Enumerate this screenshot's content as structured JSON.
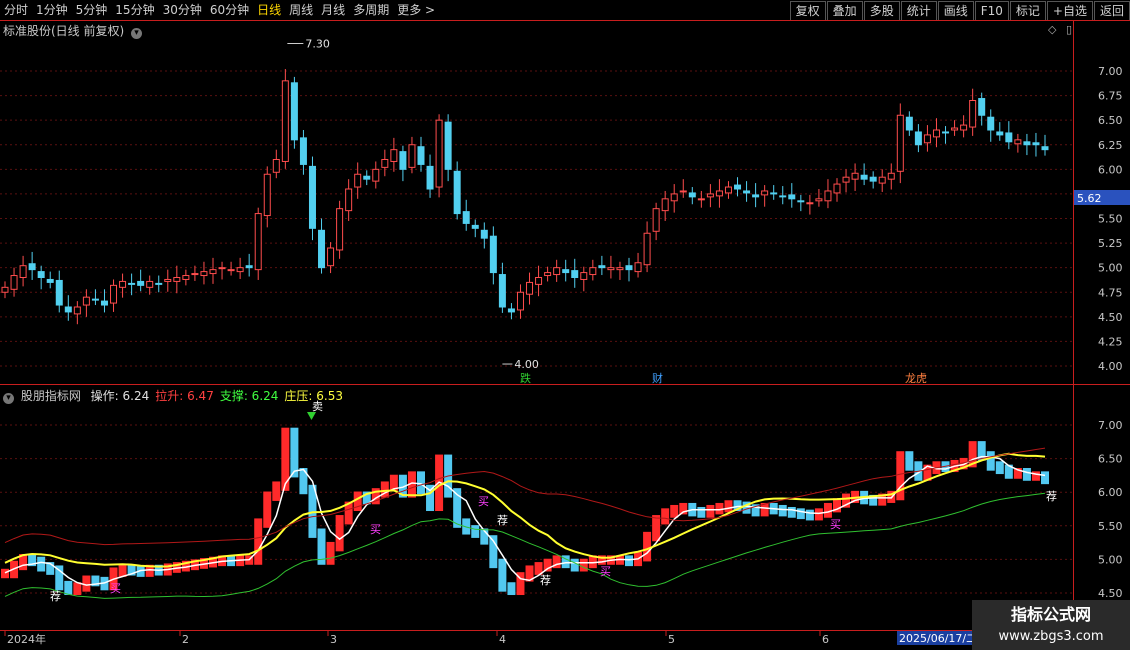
{
  "toolbar": {
    "periods": [
      "分时",
      "1分钟",
      "5分钟",
      "15分钟",
      "30分钟",
      "60分钟",
      "日线",
      "周线",
      "月线",
      "多周期",
      "更多 >"
    ],
    "active_period": "日线",
    "buttons": [
      "复权",
      "叠加",
      "多股",
      "统计",
      "画线",
      "F10",
      "标记",
      "+自选",
      "返回"
    ]
  },
  "main_chart": {
    "title": "标准股份(日线 前复权)",
    "high_label": "7.30",
    "low_label": "4.00",
    "current_price": "5.62",
    "y_ticks": [
      "7.00",
      "6.75",
      "6.50",
      "6.25",
      "6.00",
      "5.75",
      "5.50",
      "5.25",
      "5.00",
      "4.75",
      "4.50",
      "4.25",
      "4.00"
    ],
    "markers": [
      "跌",
      "财",
      "龙虎"
    ]
  },
  "indicator": {
    "name": "股朋指标网",
    "values": [
      {
        "label": "操作:",
        "value": "6.24",
        "color": "#e0e0e0"
      },
      {
        "label": "拉升:",
        "value": "6.47",
        "color": "#ff4040"
      },
      {
        "label": "支撑:",
        "value": "6.24",
        "color": "#40ff40"
      },
      {
        "label": "庄压:",
        "value": "6.53",
        "color": "#ffff40"
      }
    ],
    "y_ticks": [
      "7.00",
      "6.50",
      "6.00",
      "5.50",
      "5.00",
      "4.50"
    ],
    "signal_labels": [
      "卖",
      "买",
      "荐"
    ]
  },
  "time_axis": {
    "labels": [
      "2024年",
      "2",
      "3",
      "4",
      "5",
      "6"
    ],
    "cursor_label": "2025/06/17/二"
  },
  "watermark": {
    "title": "指标公式网",
    "url": "www.zbgs3.com"
  },
  "chart_data": {
    "type": "candlestick",
    "closes": [
      4.8,
      4.92,
      5.02,
      4.98,
      4.9,
      4.85,
      4.62,
      4.55,
      4.6,
      4.7,
      4.68,
      4.62,
      4.82,
      4.86,
      4.84,
      4.82,
      4.86,
      4.84,
      4.88,
      4.9,
      4.92,
      4.94,
      4.96,
      4.98,
      5.0,
      4.98,
      5.0,
      5.0,
      5.55,
      5.95,
      6.1,
      6.9,
      6.3,
      6.05,
      5.4,
      5.0,
      5.2,
      5.6,
      5.8,
      5.95,
      5.9,
      6.0,
      6.1,
      6.2,
      6.0,
      6.25,
      6.05,
      5.8,
      6.5,
      6.0,
      5.55,
      5.45,
      5.4,
      5.3,
      4.95,
      4.6,
      4.55,
      4.75,
      4.85,
      4.9,
      4.95,
      5.0,
      4.95,
      4.9,
      4.95,
      5.0,
      5.0,
      5.0,
      5.0,
      4.98,
      5.05,
      5.35,
      5.6,
      5.7,
      5.75,
      5.78,
      5.72,
      5.7,
      5.75,
      5.78,
      5.82,
      5.8,
      5.76,
      5.72,
      5.78,
      5.75,
      5.72,
      5.7,
      5.68,
      5.66,
      5.7,
      5.78,
      5.85,
      5.92,
      5.96,
      5.9,
      5.88,
      5.92,
      5.96,
      6.55,
      6.4,
      6.25,
      6.35,
      6.4,
      6.38,
      6.42,
      6.45,
      6.7,
      6.55,
      6.4,
      6.35,
      6.28,
      6.3,
      6.25,
      6.25,
      6.2
    ]
  }
}
